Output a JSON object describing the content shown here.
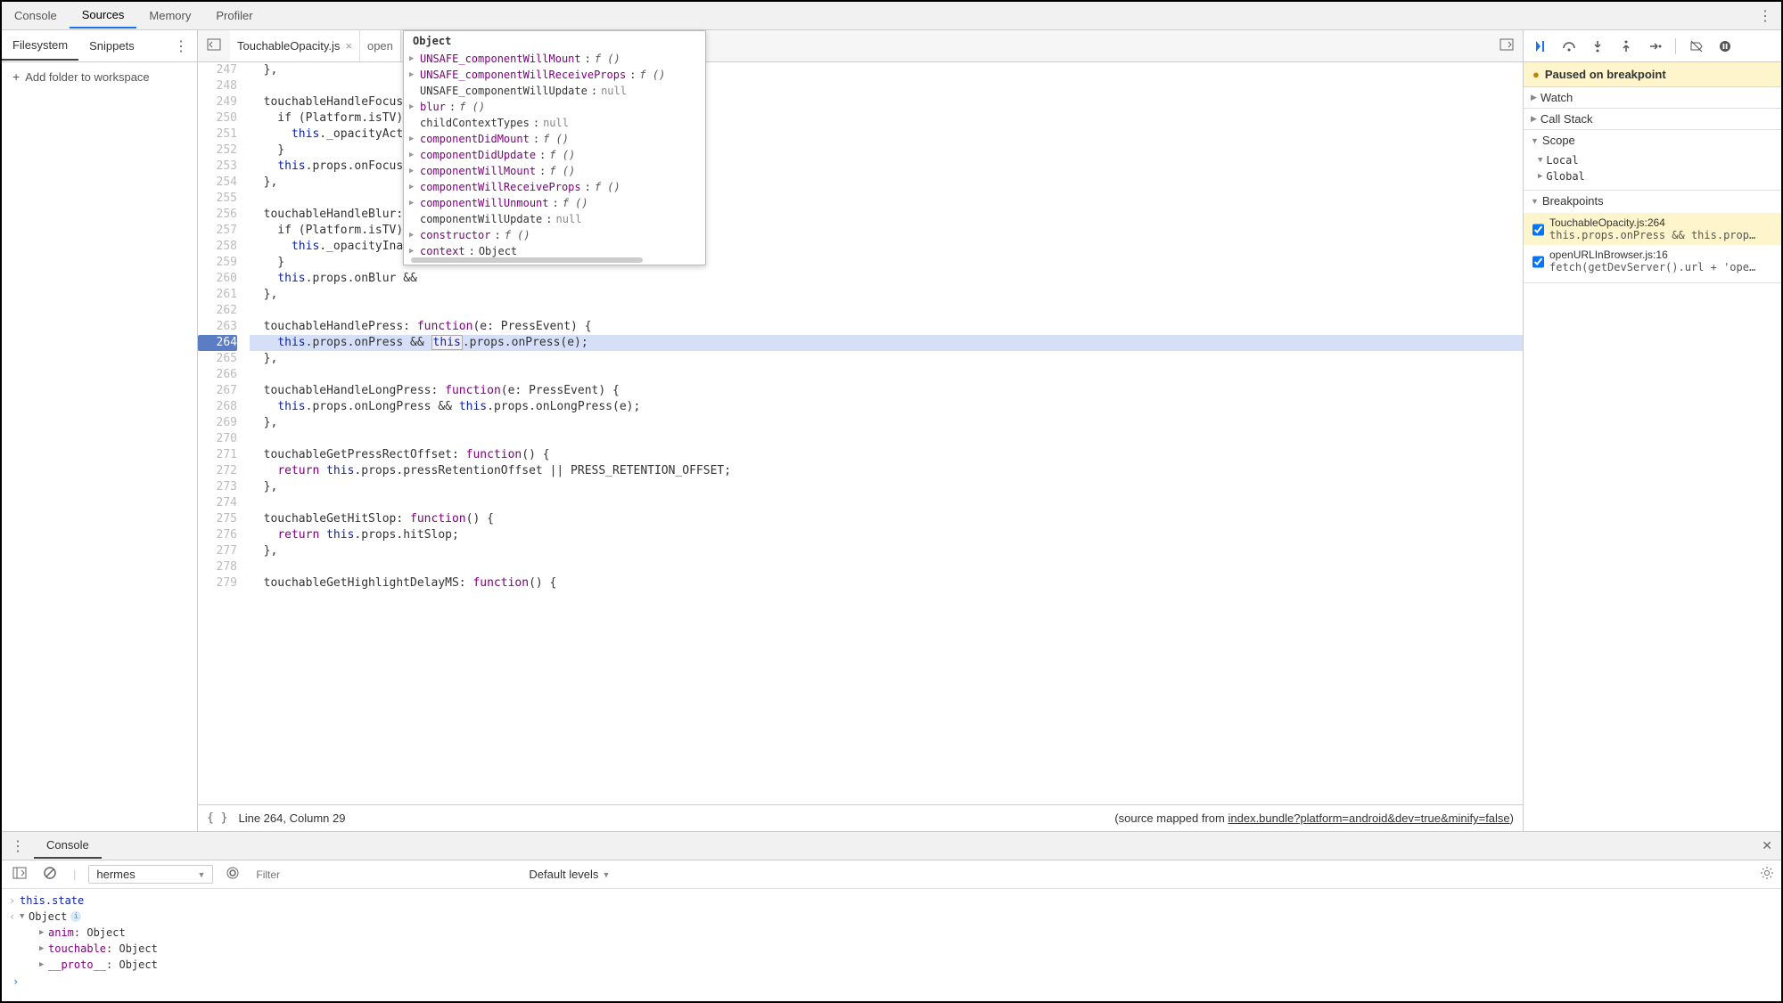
{
  "topTabs": [
    "Console",
    "Sources",
    "Memory",
    "Profiler"
  ],
  "activeTopTab": 1,
  "leftPanel": {
    "tabs": [
      "Filesystem",
      "Snippets"
    ],
    "activeTab": 0,
    "addFolderLabel": "Add folder to workspace"
  },
  "editorTabs": [
    {
      "label": "TouchableOpacity.js",
      "closable": true
    },
    {
      "label": "open",
      "closable": false,
      "partial": true
    }
  ],
  "activeEditorTab": 0,
  "codeStartLine": 247,
  "activeLine": 264,
  "codeLines": [
    "  },",
    "",
    "  touchableHandleFocus: f",
    "    if (Platform.isTV) {",
    "      this._opacityActive",
    "    }",
    "    this.props.onFocus &&",
    "  },",
    "",
    "  touchableHandleBlur: fu",
    "    if (Platform.isTV) {",
    "      this._opacityInact",
    "    }",
    "    this.props.onBlur &&",
    "  },",
    "",
    "  touchableHandlePress: function(e: PressEvent) {",
    "    this.props.onPress && this.props.onPress(e);",
    "  },",
    "",
    "  touchableHandleLongPress: function(e: PressEvent) {",
    "    this.props.onLongPress && this.props.onLongPress(e);",
    "  },",
    "",
    "  touchableGetPressRectOffset: function() {",
    "    return this.props.pressRetentionOffset || PRESS_RETENTION_OFFSET;",
    "  },",
    "",
    "  touchableGetHitSlop: function() {",
    "    return this.props.hitSlop;",
    "  },",
    "",
    "  touchableGetHighlightDelayMS: function() {"
  ],
  "statusBar": {
    "position": "Line 264, Column 29",
    "sourceMappedPrefix": "(source mapped from ",
    "sourceMappedLink": "index.bundle?platform=android&dev=true&minify=false",
    "sourceMappedSuffix": ")"
  },
  "hoverPopup": {
    "header": "Object",
    "entries": [
      {
        "expand": true,
        "name": "UNSAFE_componentWillMount",
        "kind": "fn",
        "value": "f ()"
      },
      {
        "expand": true,
        "name": "UNSAFE_componentWillReceiveProps",
        "kind": "fn",
        "value": "f ()"
      },
      {
        "expand": false,
        "name": "UNSAFE_componentWillUpdate",
        "kind": "plain",
        "value": "null"
      },
      {
        "expand": true,
        "name": "blur",
        "kind": "fn",
        "value": "f ()"
      },
      {
        "expand": false,
        "name": "childContextTypes",
        "kind": "plain",
        "value": "null"
      },
      {
        "expand": true,
        "name": "componentDidMount",
        "kind": "fn",
        "value": "f ()"
      },
      {
        "expand": true,
        "name": "componentDidUpdate",
        "kind": "fn",
        "value": "f ()"
      },
      {
        "expand": true,
        "name": "componentWillMount",
        "kind": "fn",
        "value": "f ()"
      },
      {
        "expand": true,
        "name": "componentWillReceiveProps",
        "kind": "fn",
        "value": "f ()"
      },
      {
        "expand": true,
        "name": "componentWillUnmount",
        "kind": "fn",
        "value": "f ()"
      },
      {
        "expand": false,
        "name": "componentWillUpdate",
        "kind": "plain",
        "value": "null"
      },
      {
        "expand": true,
        "name": "constructor",
        "kind": "fn",
        "value": "f ()"
      },
      {
        "expand": true,
        "name": "context",
        "kind": "obj",
        "value": "Object"
      }
    ]
  },
  "debugger": {
    "pausedBanner": "Paused on breakpoint",
    "sections": {
      "watch": "Watch",
      "callStack": "Call Stack",
      "scope": "Scope",
      "breakpoints": "Breakpoints"
    },
    "scopes": [
      "Local",
      "Global"
    ],
    "breakpoints": [
      {
        "checked": true,
        "file": "TouchableOpacity.js:264",
        "code": "this.props.onPress && this.prop…",
        "active": true
      },
      {
        "checked": true,
        "file": "openURLInBrowser.js:16",
        "code": "fetch(getDevServer().url + 'ope…",
        "active": false
      }
    ]
  },
  "consoleDrawer": {
    "tab": "Console",
    "context": "hermes",
    "filterPlaceholder": "Filter",
    "levelsLabel": "Default levels",
    "input": "this.state",
    "object": {
      "header": "Object",
      "props": [
        {
          "name": "anim",
          "value": "Object"
        },
        {
          "name": "touchable",
          "value": "Object"
        },
        {
          "name": "__proto__",
          "value": "Object"
        }
      ]
    }
  }
}
